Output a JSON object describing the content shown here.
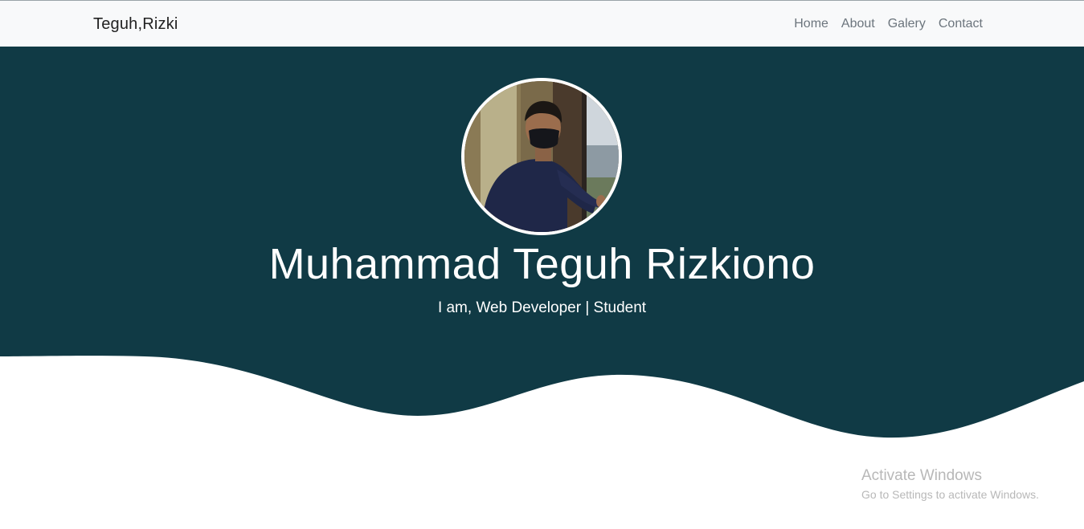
{
  "navbar": {
    "brand": "Teguh,Rizki",
    "links": [
      {
        "label": "Home"
      },
      {
        "label": "About"
      },
      {
        "label": "Galery"
      },
      {
        "label": "Contact"
      }
    ]
  },
  "hero": {
    "name": "Muhammad Teguh Rizkiono",
    "subtitle": "I am, Web Developer | Student",
    "background_color": "#103a45"
  },
  "overlay": {
    "title": "Activate Windows",
    "subtitle": "Go to Settings to activate Windows."
  },
  "colors": {
    "navbar_bg": "#f8f9fa",
    "nav_link": "#6c757d",
    "hero_bg": "#103a45"
  }
}
